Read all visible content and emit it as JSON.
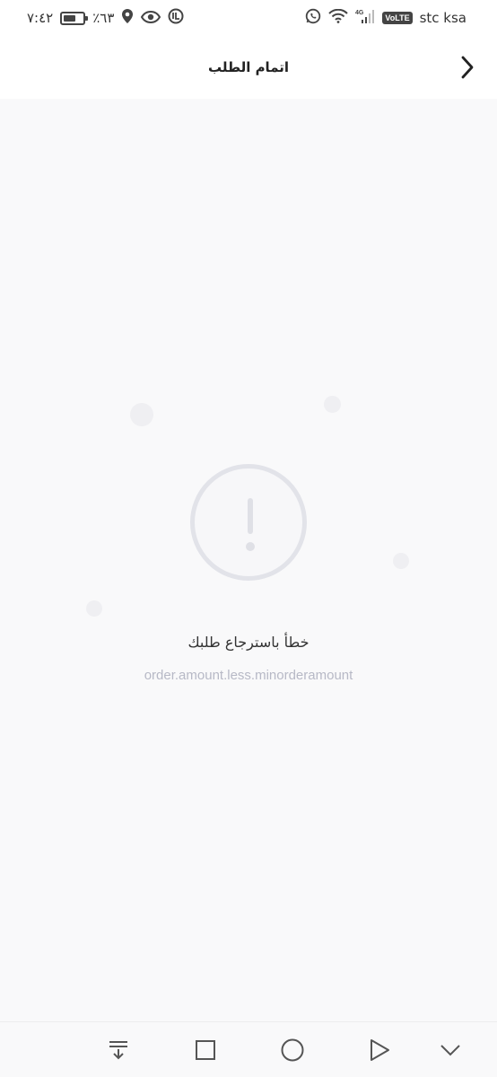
{
  "status_bar": {
    "time": "٧:٤٢",
    "battery_percent": "٪٦٣",
    "battery_level": 0.63,
    "carrier": "stc ksa",
    "volte_label": "VoLTE",
    "network_label": "4G"
  },
  "header": {
    "title": "اتمام الطلب"
  },
  "error": {
    "title": "خطأ باسترجاع طلبك",
    "code": "order.amount.less.minorderamount"
  },
  "colors": {
    "background": "#f9f9fa",
    "header_bg": "#ffffff",
    "error_icon": "#e2e3e9",
    "error_code_text": "#b7b9c6"
  }
}
